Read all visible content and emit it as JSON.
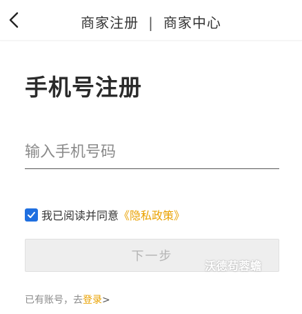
{
  "header": {
    "title_left": "商家注册",
    "separator": "|",
    "title_right": "商家中心"
  },
  "page_title": "手机号注册",
  "phone": {
    "placeholder": "输入手机号码",
    "value": ""
  },
  "agreement": {
    "checked": true,
    "text": "我已阅读并同意",
    "policy_link": "《隐私政策》"
  },
  "next_button": {
    "label": "下一步",
    "enabled": false
  },
  "watermark": "沃德苟蓉蟾",
  "login": {
    "prefix": "已有账号，去",
    "link": "登录",
    "arrow": ">"
  },
  "icons": {
    "back": "chevron-left-icon",
    "checkbox": "checkmark-icon"
  },
  "colors": {
    "accent": "#e9a100",
    "checkbox": "#1f6fe0",
    "button_bg": "#eeeeee",
    "button_text": "#b5b5b5"
  }
}
